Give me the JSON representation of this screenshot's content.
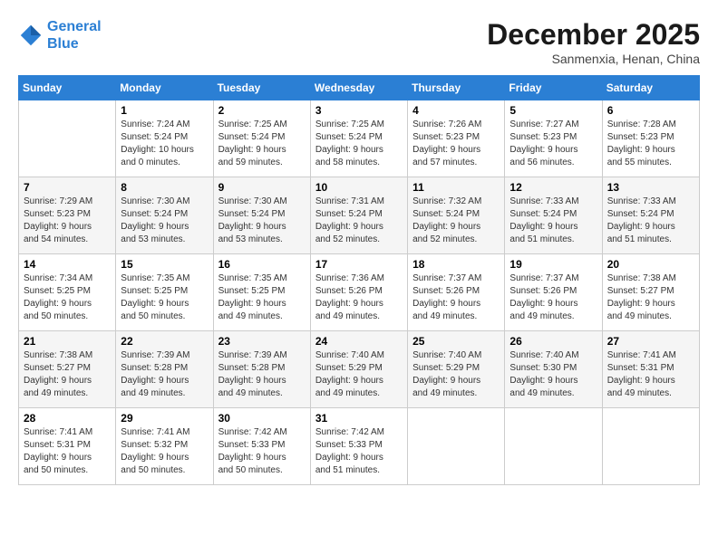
{
  "header": {
    "logo_line1": "General",
    "logo_line2": "Blue",
    "month": "December 2025",
    "location": "Sanmenxia, Henan, China"
  },
  "days_of_week": [
    "Sunday",
    "Monday",
    "Tuesday",
    "Wednesday",
    "Thursday",
    "Friday",
    "Saturday"
  ],
  "weeks": [
    [
      {
        "day": "",
        "info": ""
      },
      {
        "day": "1",
        "info": "Sunrise: 7:24 AM\nSunset: 5:24 PM\nDaylight: 10 hours\nand 0 minutes."
      },
      {
        "day": "2",
        "info": "Sunrise: 7:25 AM\nSunset: 5:24 PM\nDaylight: 9 hours\nand 59 minutes."
      },
      {
        "day": "3",
        "info": "Sunrise: 7:25 AM\nSunset: 5:24 PM\nDaylight: 9 hours\nand 58 minutes."
      },
      {
        "day": "4",
        "info": "Sunrise: 7:26 AM\nSunset: 5:23 PM\nDaylight: 9 hours\nand 57 minutes."
      },
      {
        "day": "5",
        "info": "Sunrise: 7:27 AM\nSunset: 5:23 PM\nDaylight: 9 hours\nand 56 minutes."
      },
      {
        "day": "6",
        "info": "Sunrise: 7:28 AM\nSunset: 5:23 PM\nDaylight: 9 hours\nand 55 minutes."
      }
    ],
    [
      {
        "day": "7",
        "info": "Sunrise: 7:29 AM\nSunset: 5:23 PM\nDaylight: 9 hours\nand 54 minutes."
      },
      {
        "day": "8",
        "info": "Sunrise: 7:30 AM\nSunset: 5:24 PM\nDaylight: 9 hours\nand 53 minutes."
      },
      {
        "day": "9",
        "info": "Sunrise: 7:30 AM\nSunset: 5:24 PM\nDaylight: 9 hours\nand 53 minutes."
      },
      {
        "day": "10",
        "info": "Sunrise: 7:31 AM\nSunset: 5:24 PM\nDaylight: 9 hours\nand 52 minutes."
      },
      {
        "day": "11",
        "info": "Sunrise: 7:32 AM\nSunset: 5:24 PM\nDaylight: 9 hours\nand 52 minutes."
      },
      {
        "day": "12",
        "info": "Sunrise: 7:33 AM\nSunset: 5:24 PM\nDaylight: 9 hours\nand 51 minutes."
      },
      {
        "day": "13",
        "info": "Sunrise: 7:33 AM\nSunset: 5:24 PM\nDaylight: 9 hours\nand 51 minutes."
      }
    ],
    [
      {
        "day": "14",
        "info": "Sunrise: 7:34 AM\nSunset: 5:25 PM\nDaylight: 9 hours\nand 50 minutes."
      },
      {
        "day": "15",
        "info": "Sunrise: 7:35 AM\nSunset: 5:25 PM\nDaylight: 9 hours\nand 50 minutes."
      },
      {
        "day": "16",
        "info": "Sunrise: 7:35 AM\nSunset: 5:25 PM\nDaylight: 9 hours\nand 49 minutes."
      },
      {
        "day": "17",
        "info": "Sunrise: 7:36 AM\nSunset: 5:26 PM\nDaylight: 9 hours\nand 49 minutes."
      },
      {
        "day": "18",
        "info": "Sunrise: 7:37 AM\nSunset: 5:26 PM\nDaylight: 9 hours\nand 49 minutes."
      },
      {
        "day": "19",
        "info": "Sunrise: 7:37 AM\nSunset: 5:26 PM\nDaylight: 9 hours\nand 49 minutes."
      },
      {
        "day": "20",
        "info": "Sunrise: 7:38 AM\nSunset: 5:27 PM\nDaylight: 9 hours\nand 49 minutes."
      }
    ],
    [
      {
        "day": "21",
        "info": "Sunrise: 7:38 AM\nSunset: 5:27 PM\nDaylight: 9 hours\nand 49 minutes."
      },
      {
        "day": "22",
        "info": "Sunrise: 7:39 AM\nSunset: 5:28 PM\nDaylight: 9 hours\nand 49 minutes."
      },
      {
        "day": "23",
        "info": "Sunrise: 7:39 AM\nSunset: 5:28 PM\nDaylight: 9 hours\nand 49 minutes."
      },
      {
        "day": "24",
        "info": "Sunrise: 7:40 AM\nSunset: 5:29 PM\nDaylight: 9 hours\nand 49 minutes."
      },
      {
        "day": "25",
        "info": "Sunrise: 7:40 AM\nSunset: 5:29 PM\nDaylight: 9 hours\nand 49 minutes."
      },
      {
        "day": "26",
        "info": "Sunrise: 7:40 AM\nSunset: 5:30 PM\nDaylight: 9 hours\nand 49 minutes."
      },
      {
        "day": "27",
        "info": "Sunrise: 7:41 AM\nSunset: 5:31 PM\nDaylight: 9 hours\nand 49 minutes."
      }
    ],
    [
      {
        "day": "28",
        "info": "Sunrise: 7:41 AM\nSunset: 5:31 PM\nDaylight: 9 hours\nand 50 minutes."
      },
      {
        "day": "29",
        "info": "Sunrise: 7:41 AM\nSunset: 5:32 PM\nDaylight: 9 hours\nand 50 minutes."
      },
      {
        "day": "30",
        "info": "Sunrise: 7:42 AM\nSunset: 5:33 PM\nDaylight: 9 hours\nand 50 minutes."
      },
      {
        "day": "31",
        "info": "Sunrise: 7:42 AM\nSunset: 5:33 PM\nDaylight: 9 hours\nand 51 minutes."
      },
      {
        "day": "",
        "info": ""
      },
      {
        "day": "",
        "info": ""
      },
      {
        "day": "",
        "info": ""
      }
    ]
  ]
}
